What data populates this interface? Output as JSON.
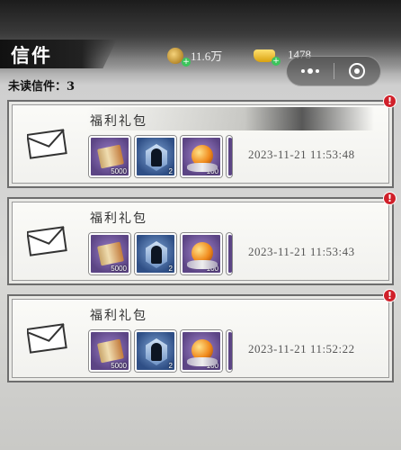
{
  "header": {
    "title": "信件",
    "copper_amount": "11.6万",
    "gold_amount": "1478",
    "copper_icon": "copper-coin-icon",
    "gold_icon": "gold-ingot-icon"
  },
  "unread_label": "未读信件：3",
  "badge_symbol": "!",
  "mails": [
    {
      "subject": "福利礼包",
      "time": "2023-11-21 11:53:48",
      "highlighted": true,
      "items": [
        {
          "icon": "scroll-icon",
          "qty": "5000"
        },
        {
          "icon": "hero-token-icon",
          "qty": "2"
        },
        {
          "icon": "orb-icon",
          "qty": "100"
        }
      ]
    },
    {
      "subject": "福利礼包",
      "time": "2023-11-21 11:53:43",
      "highlighted": false,
      "items": [
        {
          "icon": "scroll-icon",
          "qty": "5000"
        },
        {
          "icon": "hero-token-icon",
          "qty": "2"
        },
        {
          "icon": "orb-icon",
          "qty": "100"
        }
      ]
    },
    {
      "subject": "福利礼包",
      "time": "2023-11-21 11:52:22",
      "highlighted": false,
      "items": [
        {
          "icon": "scroll-icon",
          "qty": "5000"
        },
        {
          "icon": "hero-token-icon",
          "qty": "2"
        },
        {
          "icon": "orb-icon",
          "qty": "100"
        }
      ]
    }
  ],
  "colors": {
    "badge": "#d0202a",
    "currency_plus": "#3cc45b"
  }
}
